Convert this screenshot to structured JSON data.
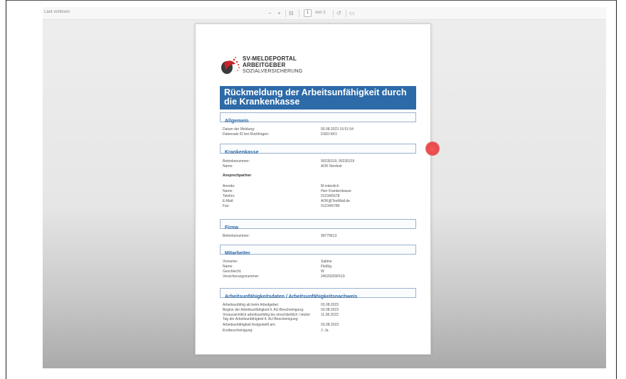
{
  "toolbar": {
    "read_aloud": "Laut vorlesen",
    "zoom_out": "−",
    "zoom_in": "+",
    "fit": "⊟",
    "page_number": "1",
    "page_of": "von 1",
    "rotate": "↺",
    "more": "▭"
  },
  "logo": {
    "line1": "SV-MELDEPORTAL",
    "line2": "ARBEITGEBER",
    "line3": "SOZIALVERSICHERUNG"
  },
  "document": {
    "title": "Rückmeldung der Arbeitsunfähigkeit durch die Krankenkasse",
    "sections": {
      "allgemein": {
        "heading": "Allgemein",
        "rows": [
          {
            "label": "Datum der Meldung:",
            "value": "00.08.2023 16:51:54"
          },
          {
            "label": "Datensatz ID bei Rückfragen:",
            "value": "DSID-KK1"
          }
        ]
      },
      "krankenkasse": {
        "heading": "Krankenkasse",
        "rows": [
          {
            "label": "Betriebsnummer:",
            "value": "90235319, 90235319"
          },
          {
            "label": "Name:",
            "value": "AOK Nordost"
          }
        ],
        "contact_heading": "Ansprechpartner",
        "contact_rows": [
          {
            "label": "Anrede:",
            "value": "M männlich"
          },
          {
            "label": "Name:",
            "value": "Herr Krankenkasse"
          },
          {
            "label": "Telefon:",
            "value": "01234/5678"
          },
          {
            "label": "E-Mail:",
            "value": "AOK@TestMail.de"
          },
          {
            "label": "Fax:",
            "value": "01234/6789"
          }
        ]
      },
      "firma": {
        "heading": "Firma",
        "rows": [
          {
            "label": "Betriebsnummer:",
            "value": "99779613"
          }
        ]
      },
      "mitarbeiter": {
        "heading": "Mitarbeiter",
        "rows": [
          {
            "label": "Vorname:",
            "value": "Sabine"
          },
          {
            "label": "Name:",
            "value": "Fleißig"
          },
          {
            "label": "Geschlecht:",
            "value": "W"
          },
          {
            "label": "Versicherungsnummer:",
            "value": "24020200F519"
          }
        ]
      },
      "au": {
        "heading": "Arbeitsunfähigkeitsdaten / Arbeitsunfähigkeitsnachweis",
        "rows": [
          {
            "label": "Arbeitsunfähig ab beim Arbeitgeber:",
            "value": "03.08.2023"
          },
          {
            "label": "Beginn der Arbeitsunfähigkeit lt. AU-Bescheinigung:",
            "value": "03.08.2023"
          },
          {
            "label": "Voraussichtlich arbeitsunfähig bis einschließlich / letzter",
            "value": "11.08.2023"
          },
          {
            "label": "Tag der Arbeitsunfähigkeit lt. AU-Bescheinigung:",
            "value": ""
          },
          {
            "label": "Arbeitsunfähigkeit festgestellt am:",
            "value": "03.08.2023"
          },
          {
            "label": "Erstbescheinigung:",
            "value": "J: Ja"
          }
        ]
      }
    }
  }
}
